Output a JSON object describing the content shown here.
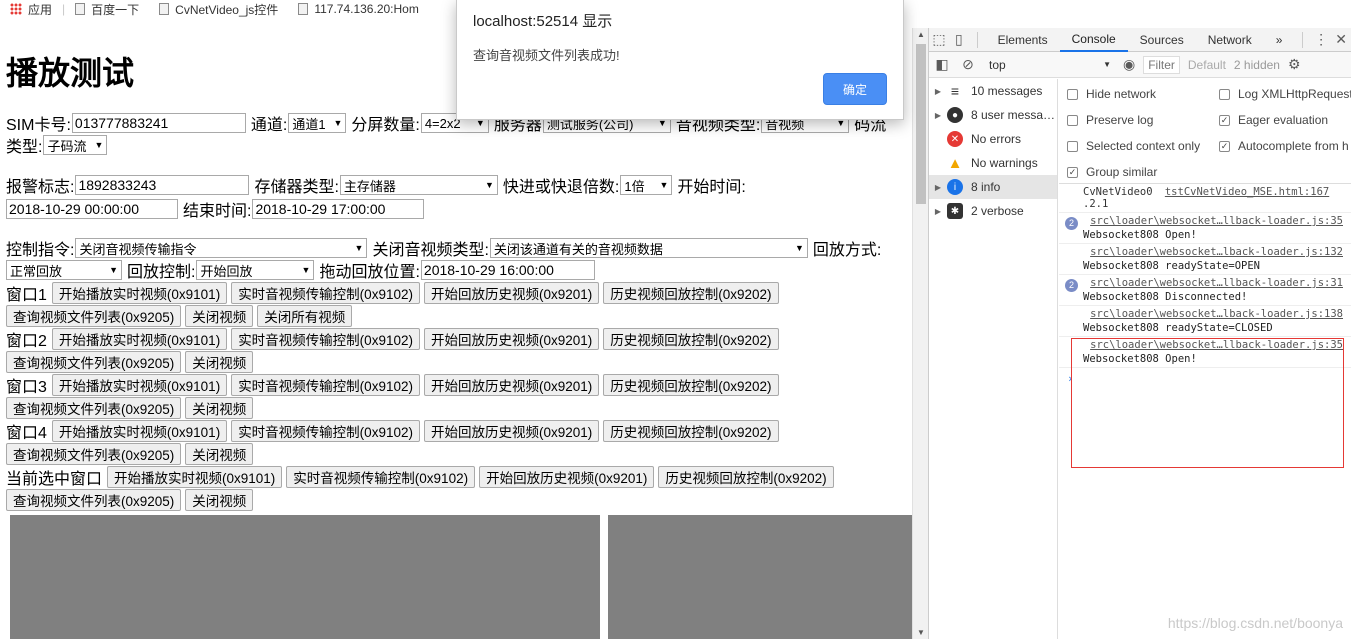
{
  "bookmarks": [
    {
      "label": "应用",
      "icon": "apps-icon"
    },
    {
      "label": "百度一下",
      "icon": "page-icon"
    },
    {
      "label": "CvNetVideo_js控件",
      "icon": "page-icon"
    },
    {
      "label": "117.74.136.20:Hom",
      "icon": "page-icon"
    }
  ],
  "page": {
    "title": "播放测试",
    "row1": {
      "sim_label": "SIM卡号:",
      "sim_value": "013777883241",
      "channel_label": "通道:",
      "channel_value": "通道1",
      "split_label": "分屏数量:",
      "split_value": "4=2x2",
      "server_label": "服务器",
      "server_value": "测试服务(公司)",
      "media_label": "音视频类型:",
      "media_value": "音视频",
      "stream_label": "码流"
    },
    "row2": {
      "type_label": "类型:",
      "type_value": "子码流"
    },
    "row3": {
      "alarm_label": "报警标志:",
      "alarm_value": "1892833243",
      "storage_label": "存储器类型:",
      "storage_value": "主存储器",
      "speed_label": "快进或快退倍数:",
      "speed_value": "1倍",
      "start_label": "开始时间:"
    },
    "row4": {
      "start_value": "2018-10-29 00:00:00",
      "end_label": "结束时间:",
      "end_value": "2018-10-29 17:00:00"
    },
    "row5": {
      "cmd_label": "控制指令:",
      "cmd_value": "关闭音视频传输指令",
      "close_type_label": "关闭音视频类型:",
      "close_type_value": "关闭该通道有关的音视频数据",
      "playmode_label": "回放方式:"
    },
    "row6": {
      "playmode_value": "正常回放",
      "ctrl_label": "回放控制:",
      "ctrl_value": "开始回放",
      "drag_label": "拖动回放位置:",
      "drag_value": "2018-10-29 16:00:00"
    },
    "buttons": {
      "start_live": "开始播放实时视频(0x9101)",
      "live_ctrl": "实时音视频传输控制(0x9102)",
      "start_history": "开始回放历史视频(0x9201)",
      "history_ctrl": "历史视频回放控制(0x9202)",
      "query_list": "查询视频文件列表(0x9205)",
      "close_video": "关闭视频",
      "close_all": "关闭所有视频"
    },
    "windows": [
      "窗口1",
      "窗口2",
      "窗口3",
      "窗口4",
      "当前选中窗口"
    ]
  },
  "alert": {
    "origin": "localhost:52514 显示",
    "message": "查询音视频文件列表成功!",
    "ok_label": "确定",
    "ok_color": "#4a8ff5"
  },
  "devtools": {
    "tabs": [
      "Elements",
      "Console",
      "Sources",
      "Network"
    ],
    "active_tab": "Console",
    "more_tabs": "»",
    "context": "top",
    "filter_placeholder": "Filter",
    "levels": "Default",
    "hidden": "2 hidden",
    "sidebar": [
      {
        "label": "10 messages",
        "icon": "list-icon"
      },
      {
        "label": "8 user messa…",
        "icon": "user-icon"
      },
      {
        "label": "No errors",
        "icon": "error-icon"
      },
      {
        "label": "No warnings",
        "icon": "warning-icon"
      },
      {
        "label": "8 info",
        "icon": "info-icon"
      },
      {
        "label": "2 verbose",
        "icon": "bug-icon"
      }
    ],
    "settings": [
      {
        "label": "Hide network",
        "checked": false
      },
      {
        "label": "Log XMLHttpRequests",
        "checked": false
      },
      {
        "label": "Preserve log",
        "checked": false
      },
      {
        "label": "Eager evaluation",
        "checked": true
      },
      {
        "label": "Selected context only",
        "checked": false
      },
      {
        "label": "Autocomplete from h",
        "checked": true
      },
      {
        "label": "Group similar",
        "checked": true
      }
    ],
    "messages": [
      {
        "count": "",
        "text": "CvNetVideo0 ",
        "link": "tstCvNetVideo_MSE.html:167",
        "text2": ".2.1"
      },
      {
        "count": "2",
        "link": "src\\loader\\websocket…llback-loader.js:35",
        "text": "Websocket808 Open!"
      },
      {
        "count": "",
        "link": "src\\loader\\websocket…lback-loader.js:132",
        "text": "Websocket808 readyState=OPEN"
      },
      {
        "count": "2",
        "link": "src\\loader\\websocket…llback-loader.js:31",
        "text": "Websocket808 Disconnected!"
      },
      {
        "count": "",
        "link": "src\\loader\\websocket…lback-loader.js:138",
        "text": "Websocket808 readyState=CLOSED"
      },
      {
        "count": "",
        "link": "src\\loader\\websocket…llback-loader.js:35",
        "text": "Websocket808 Open!"
      }
    ],
    "prompt": "›"
  },
  "watermark": "https://blog.csdn.net/boonya"
}
